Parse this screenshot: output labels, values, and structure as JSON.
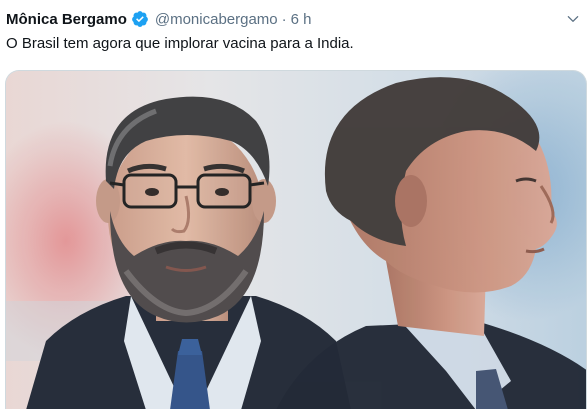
{
  "tweet": {
    "display_name": "Mônica Bergamo",
    "verified": true,
    "handle": "@monicabergamo",
    "separator": "·",
    "timestamp": "6 h",
    "text": "O Brasil tem agora que implorar vacina para a India."
  },
  "icons": {
    "verified": "verified-badge-icon",
    "menu": "chevron-down-icon"
  },
  "colors": {
    "verified_blue": "#1da1f2",
    "secondary_text": "#5b7083",
    "primary_text": "#0f1419"
  }
}
